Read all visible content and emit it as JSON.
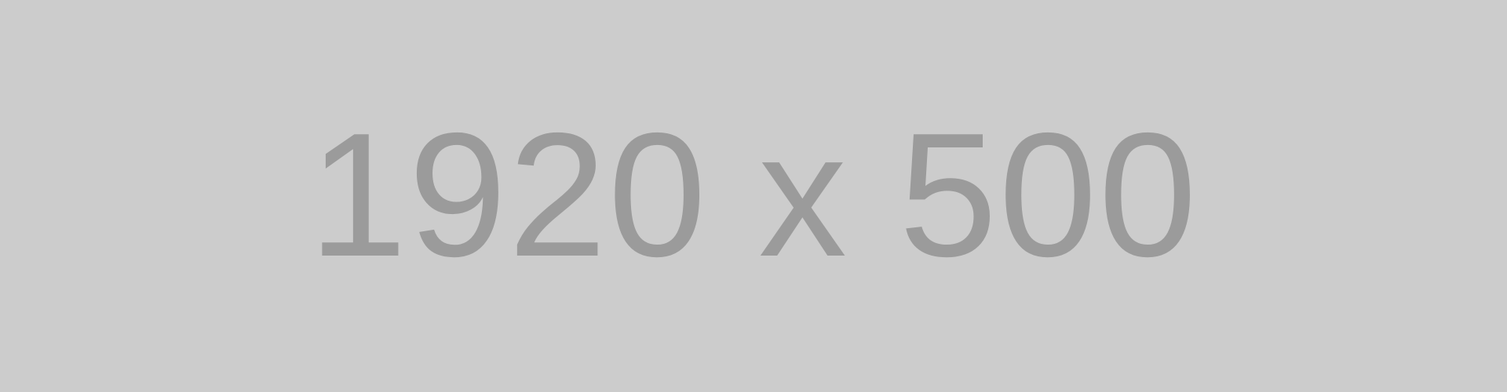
{
  "placeholder": {
    "label": "1920 x 500",
    "background_color": "#cccccc",
    "text_color": "#9b9b9b"
  }
}
